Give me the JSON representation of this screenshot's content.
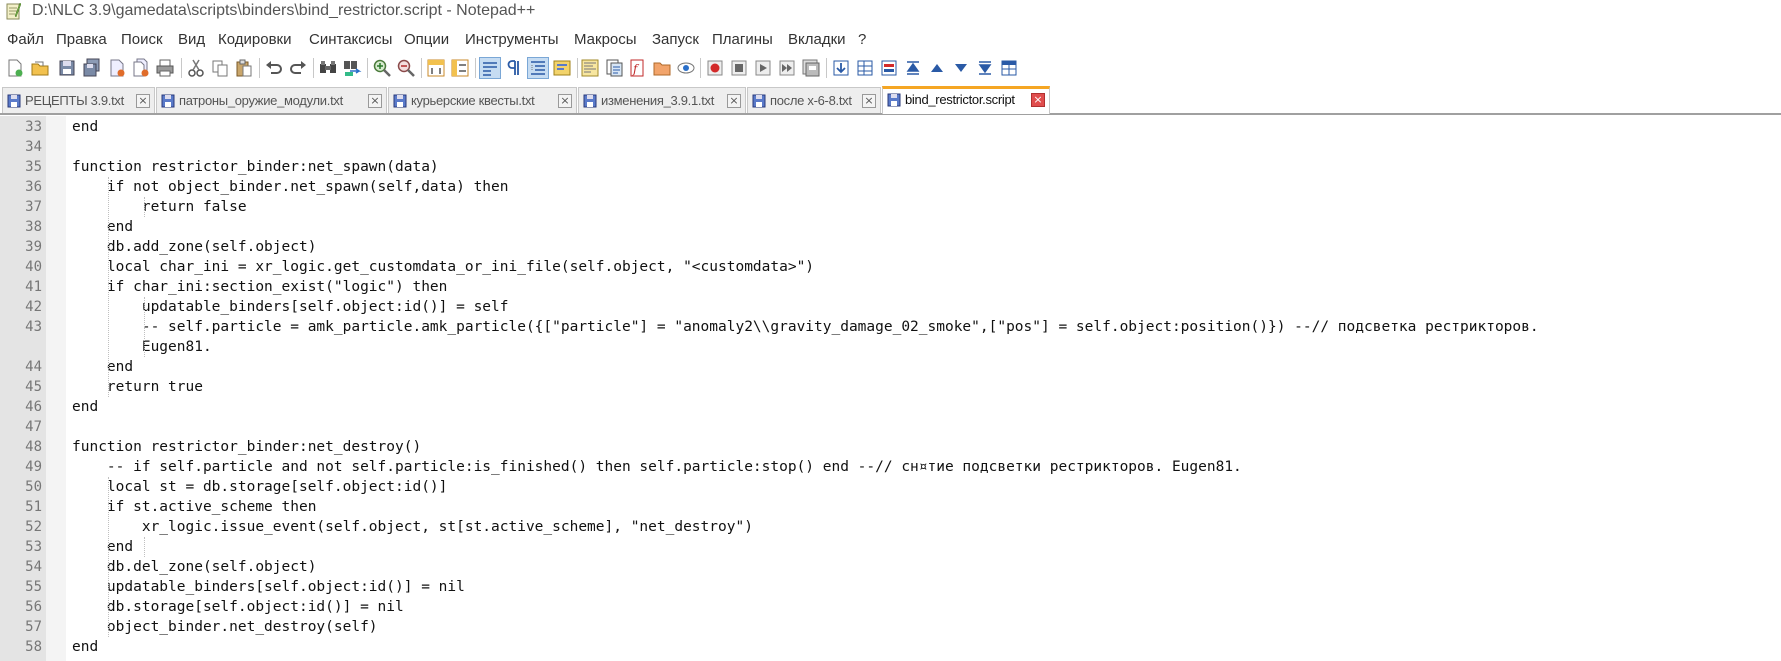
{
  "window": {
    "title": "D:\\NLC 3.9\\gamedata\\scripts\\binders\\bind_restrictor.script - Notepad++"
  },
  "menu": [
    "Файл",
    "Правка",
    "Поиск",
    "Вид",
    "Кодировки",
    "Синтаксисы",
    "Опции",
    "Инструменты",
    "Макросы",
    "Запуск",
    "Плагины",
    "Вкладки",
    "?"
  ],
  "toolbar": {
    "icons": [
      "new-file-icon",
      "open-file-icon",
      "save-icon",
      "save-all-icon",
      "close-icon",
      "close-all-icon",
      "print-icon",
      "cut-icon",
      "copy-icon",
      "paste-icon",
      "undo-icon",
      "redo-icon",
      "find-icon",
      "replace-icon",
      "zoom-in-icon",
      "zoom-out-icon",
      "sync-vertical-icon",
      "sync-horizontal-icon",
      "word-wrap-icon",
      "show-all-chars-icon",
      "indent-guide-icon",
      "user-language-icon",
      "document-map-icon",
      "function-list-icon",
      "folder-workspace-icon",
      "monitoring-icon",
      "record-macro-icon",
      "stop-macro-icon",
      "play-macro-icon",
      "run-macro-multiple-icon",
      "save-macro-icon",
      "plugin-1-icon",
      "plugin-2-icon",
      "plugin-3-icon",
      "plugin-4-icon",
      "plugin-5-icon",
      "plugin-6-icon",
      "plugin-7-icon"
    ]
  },
  "tabs": [
    {
      "label": "РЕЦЕПТЫ 3.9.txt",
      "active": false
    },
    {
      "label": "патроны_оружие_модули.txt",
      "active": false
    },
    {
      "label": "курьерские квесты.txt",
      "active": false
    },
    {
      "label": "изменения_3.9.1.txt",
      "active": false
    },
    {
      "label": "после х-6-8.txt",
      "active": false
    },
    {
      "label": "bind_restrictor.script",
      "active": true
    }
  ],
  "editor": {
    "lines": [
      {
        "num": "33",
        "text": "end"
      },
      {
        "num": "34",
        "text": ""
      },
      {
        "num": "35",
        "text": "function restrictor_binder:net_spawn(data)"
      },
      {
        "num": "36",
        "text": "    if not object_binder.net_spawn(self,data) then"
      },
      {
        "num": "37",
        "text": "        return false"
      },
      {
        "num": "38",
        "text": "    end"
      },
      {
        "num": "39",
        "text": "    db.add_zone(self.object)"
      },
      {
        "num": "40",
        "text": "    local char_ini = xr_logic.get_customdata_or_ini_file(self.object, \"<customdata>\")"
      },
      {
        "num": "41",
        "text": "    if char_ini:section_exist(\"logic\") then"
      },
      {
        "num": "42",
        "text": "        updatable_binders[self.object:id()] = self"
      },
      {
        "num": "43",
        "text": "        -- self.particle = amk_particle.amk_particle({[\"particle\"] = \"anomaly2\\\\gravity_damage_02_smoke\",[\"pos\"] = self.object:position()}) --// подсветка рестрикторов."
      },
      {
        "num": "",
        "text": "        Eugen81."
      },
      {
        "num": "44",
        "text": "    end"
      },
      {
        "num": "45",
        "text": "    return true"
      },
      {
        "num": "46",
        "text": "end"
      },
      {
        "num": "47",
        "text": ""
      },
      {
        "num": "48",
        "text": "function restrictor_binder:net_destroy()"
      },
      {
        "num": "49",
        "text": "    -- if self.particle and not self.particle:is_finished() then self.particle:stop() end --// сн¤тие подсветки рестрикторов. Eugen81."
      },
      {
        "num": "50",
        "text": "    local st = db.storage[self.object:id()]"
      },
      {
        "num": "51",
        "text": "    if st.active_scheme then"
      },
      {
        "num": "52",
        "text": "        xr_logic.issue_event(self.object, st[st.active_scheme], \"net_destroy\")"
      },
      {
        "num": "53",
        "text": "    end"
      },
      {
        "num": "54",
        "text": "    db.del_zone(self.object)"
      },
      {
        "num": "55",
        "text": "    updatable_binders[self.object:id()] = nil"
      },
      {
        "num": "56",
        "text": "    db.storage[self.object:id()] = nil"
      },
      {
        "num": "57",
        "text": "    object_binder.net_destroy(self)"
      },
      {
        "num": "58",
        "text": "end"
      }
    ]
  }
}
